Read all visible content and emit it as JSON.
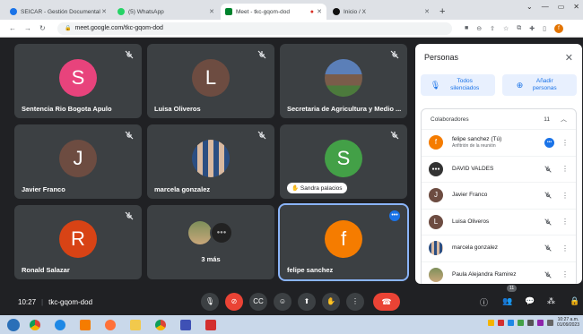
{
  "browser": {
    "tabs": [
      {
        "label": "SEICAR - Gestión Documental",
        "color": "#1a73e8",
        "active": false
      },
      {
        "label": "(5) WhatsApp",
        "color": "#25d366",
        "active": false
      },
      {
        "label": "Meet - tkc-gqom-dod",
        "color": "#00832d",
        "active": true
      },
      {
        "label": "Inicio / X",
        "color": "#111111",
        "active": false
      }
    ],
    "url": "meet.google.com/tkc-gqom-dod"
  },
  "tiles": [
    {
      "name": "Sentencia Rio Bogota Apulo",
      "initial": "S",
      "color": "#e8437c",
      "muted": true
    },
    {
      "name": "Luisa Oliveros",
      "initial": "L",
      "color": "#6d4c41",
      "muted": true
    },
    {
      "name": "Secretaria de Agricultura y Medio ...",
      "initial": "",
      "color": "#7a8fa6",
      "muted": true,
      "photo": true
    },
    {
      "name": "Javier Franco",
      "initial": "J",
      "color": "#6d4c41",
      "muted": true
    },
    {
      "name": "marcela gonzalez",
      "initial": "",
      "color": "#2b4e82",
      "muted": true,
      "photo": true
    },
    {
      "name": "Sandra palacios",
      "initial": "S",
      "color": "#43a047",
      "muted": true,
      "pill": true
    },
    {
      "name": "Ronald Salazar",
      "initial": "R",
      "color": "#d84315",
      "muted": true
    },
    {
      "name": "3 más",
      "initial": "",
      "color": "#3c4043",
      "muted": false
    },
    {
      "name": "felipe sanchez",
      "initial": "f",
      "color": "#f57c00",
      "muted": false
    }
  ],
  "panel": {
    "title": "Personas",
    "mute_all": "Todos silenciados",
    "add_people": "Añadir personas",
    "section_label": "Colaboradores",
    "section_count": "11",
    "people": [
      {
        "name": "felipe sanchez (Tú)",
        "sub": "Anfitrión de la reunión",
        "initial": "f",
        "color": "#f57c00"
      },
      {
        "name": "DAVID VALDES",
        "sub": "",
        "initial": "",
        "color": "#333333"
      },
      {
        "name": "Javier Franco",
        "sub": "",
        "initial": "J",
        "color": "#6d4c41"
      },
      {
        "name": "Luisa Oliveros",
        "sub": "",
        "initial": "L",
        "color": "#6d4c41"
      },
      {
        "name": "marcela gonzalez",
        "sub": "",
        "initial": "",
        "color": "#2b4e82"
      },
      {
        "name": "Paula Alejandra Ramirez",
        "sub": "",
        "initial": "",
        "color": "#7d8f5a"
      }
    ]
  },
  "bottombar": {
    "time": "10:27",
    "code": "tkc-gqom-dod",
    "people_count": "11"
  },
  "taskbar": {
    "time": "10:27 a.m.",
    "date": "01/09/2023"
  }
}
